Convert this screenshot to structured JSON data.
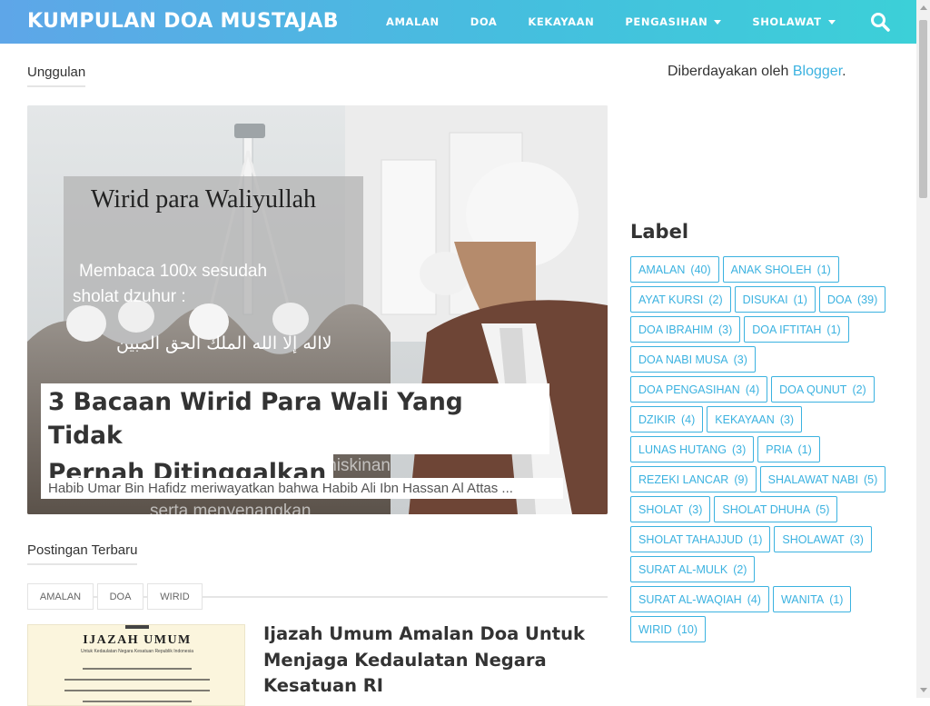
{
  "header": {
    "site_title": "KUMPULAN DOA MUSTAJAB",
    "menu": [
      {
        "label": "AMALAN",
        "dropdown": false
      },
      {
        "label": "DOA",
        "dropdown": false
      },
      {
        "label": "KEKAYAAN",
        "dropdown": false
      },
      {
        "label": "PENGASIHAN",
        "dropdown": true
      },
      {
        "label": "SHOLAWAT",
        "dropdown": true
      }
    ],
    "search_icon": "search-icon"
  },
  "featured_section": {
    "heading": "Unggulan",
    "post": {
      "title_line1": "3 Bacaan Wirid Para Wali Yang Tidak",
      "title_line2": "Pernah Ditinggalkan",
      "snippet": "Habib Umar Bin Hafidz meriwayatkan bahwa Habib Ali Ibn Hassan Al Attas ...",
      "image_texts": {
        "caption_title": "Wirid para Waliyullah",
        "caption_line1": "Membaca 100x sesudah",
        "caption_line2": "sholat dzuhur :",
        "arabic": "لااله إلا الله الملك الحق المبين",
        "overlay_bottom1": "(dijadikan) dan kemiskinan",
        "overlay_bottom2": "serta menyenangkan"
      }
    }
  },
  "recent_section": {
    "heading": "Postingan Terbaru",
    "post": {
      "tags": [
        "AMALAN",
        "DOA",
        "WIRID"
      ],
      "title": "Ijazah Umum Amalan Doa Untuk Menjaga Kedaulatan Negara Kesatuan RI",
      "thumb_texts": {
        "heading": "IJAZAH UMUM",
        "sub": "Untuk Kedaulatan Negara Kesatuan Republik Indonesia"
      }
    }
  },
  "sidebar": {
    "powered_prefix": "Diberdayakan oleh ",
    "powered_link": "Blogger",
    "powered_suffix": ".",
    "label_heading": "Label",
    "labels": [
      {
        "name": "AMALAN",
        "count": "(40)"
      },
      {
        "name": "ANAK SHOLEH",
        "count": "(1)"
      },
      {
        "name": "AYAT KURSI",
        "count": "(2)"
      },
      {
        "name": "DISUKAI",
        "count": "(1)"
      },
      {
        "name": "DOA",
        "count": "(39)"
      },
      {
        "name": "DOA IBRAHIM",
        "count": "(3)"
      },
      {
        "name": "DOA IFTITAH",
        "count": "(1)"
      },
      {
        "name": "DOA NABI MUSA",
        "count": "(3)"
      },
      {
        "name": "DOA PENGASIHAN",
        "count": "(4)"
      },
      {
        "name": "DOA QUNUT",
        "count": "(2)"
      },
      {
        "name": "DZIKIR",
        "count": "(4)"
      },
      {
        "name": "KEKAYAAN",
        "count": "(3)"
      },
      {
        "name": "LUNAS HUTANG",
        "count": "(3)"
      },
      {
        "name": "PRIA",
        "count": "(1)"
      },
      {
        "name": "REZEKI LANCAR",
        "count": "(9)"
      },
      {
        "name": "SHALAWAT NABI",
        "count": "(5)"
      },
      {
        "name": "SHOLAT",
        "count": "(3)"
      },
      {
        "name": "SHOLAT DHUHA",
        "count": "(5)"
      },
      {
        "name": "SHOLAT TAHAJJUD",
        "count": "(1)"
      },
      {
        "name": "SHOLAWAT",
        "count": "(3)"
      },
      {
        "name": "SURAT AL-MULK",
        "count": "(2)"
      },
      {
        "name": "SURAT AL-WAQIAH",
        "count": "(4)"
      },
      {
        "name": "WANITA",
        "count": "(1)"
      },
      {
        "name": "WIRID",
        "count": "(10)"
      }
    ]
  },
  "colors": {
    "nav_gradient_start": "#5ea6e8",
    "nav_gradient_end": "#3cd0d8",
    "accent": "#3bb2e0"
  }
}
